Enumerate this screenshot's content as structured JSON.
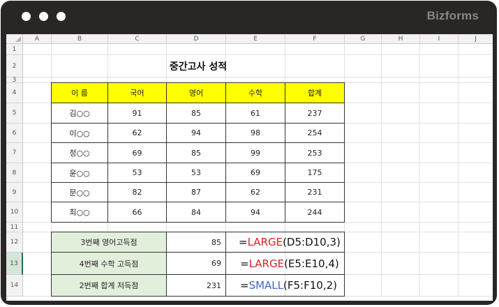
{
  "window": {
    "brand": "Bizforms",
    "accent_dot_color": "#ffffff",
    "frame_color": "#2a2626"
  },
  "sheet": {
    "columns": [
      "A",
      "B",
      "C",
      "D",
      "E",
      "F",
      "G",
      "H",
      "I",
      "J"
    ],
    "rows": [
      "1",
      "2",
      "3",
      "4",
      "5",
      "6",
      "7",
      "8",
      "9",
      "10",
      "11",
      "12",
      "13",
      "14"
    ],
    "selected_row": "13",
    "title": "중간고사 성적",
    "score_table": {
      "header_fill": "#ffff00",
      "headers": [
        "이 름",
        "국어",
        "영어",
        "수학",
        "합계"
      ],
      "rows": [
        [
          "김○○",
          "91",
          "85",
          "61",
          "237"
        ],
        [
          "이○○",
          "62",
          "94",
          "98",
          "254"
        ],
        [
          "정○○",
          "69",
          "85",
          "99",
          "253"
        ],
        [
          "윤○○",
          "53",
          "53",
          "69",
          "175"
        ],
        [
          "문○○",
          "82",
          "87",
          "62",
          "231"
        ],
        [
          "최○○",
          "66",
          "84",
          "94",
          "244"
        ]
      ]
    },
    "function_table": {
      "label_fill": "#e2efda",
      "rows": [
        {
          "label": "3번째 영어고득점",
          "value": "85",
          "eq": "=",
          "fn": "LARGE",
          "args": "(D5:D10,3)",
          "fn_color": "#e02020"
        },
        {
          "label": "4번째 수학 고득점",
          "value": "69",
          "eq": "=",
          "fn": "LARGE",
          "args": "(E5:E10,4)",
          "fn_color": "#e02020"
        },
        {
          "label": "2번째 합계 저득점",
          "value": "231",
          "eq": "=",
          "fn": "SMALL",
          "args": "(F5:F10,2)",
          "fn_color": "#3a66c8"
        }
      ]
    }
  }
}
